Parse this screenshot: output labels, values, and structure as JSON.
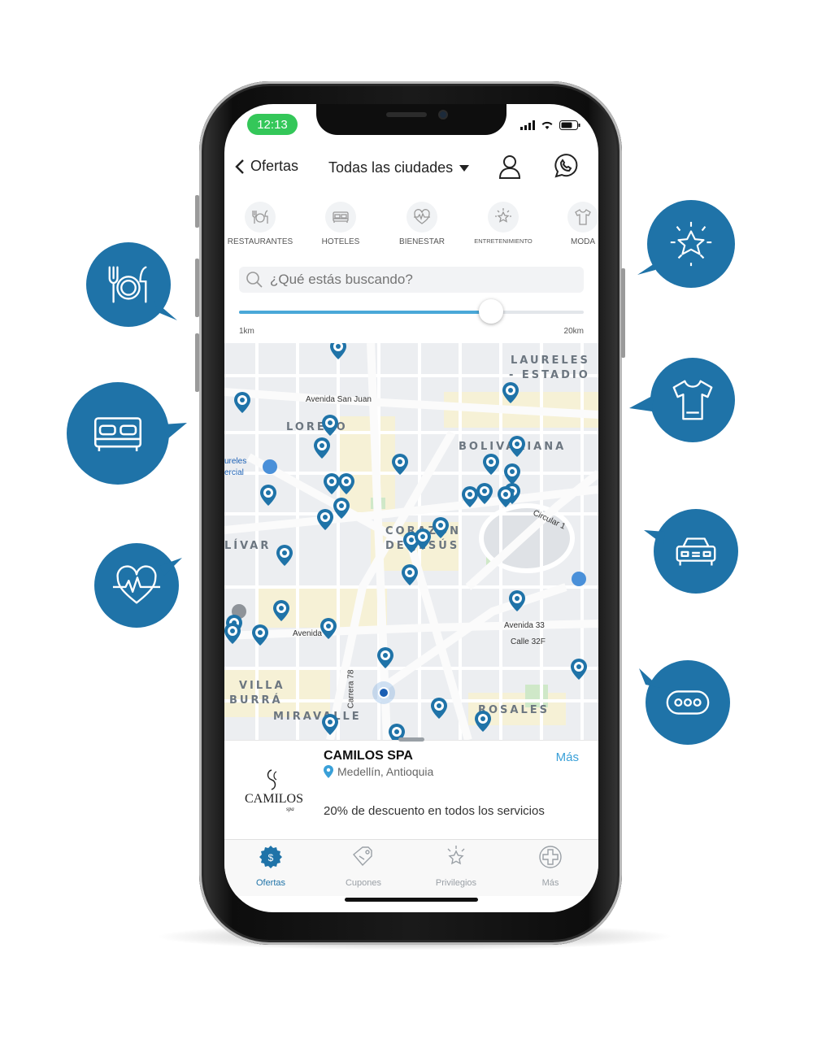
{
  "status": {
    "time": "12:13"
  },
  "header": {
    "back_label": "Ofertas",
    "city": "Todas las ciudades"
  },
  "categories": [
    {
      "label": "RESTAURANTES",
      "icon": "restaurant-icon"
    },
    {
      "label": "HOTELES",
      "icon": "bed-icon"
    },
    {
      "label": "BIENESTAR",
      "icon": "heart-pulse-icon"
    },
    {
      "label": "ENTRETENIMIENTO",
      "icon": "star-burst-icon"
    },
    {
      "label": "MODA",
      "icon": "tshirt-icon"
    }
  ],
  "search": {
    "placeholder": "¿Qué estás buscando?"
  },
  "radius": {
    "min_label": "1km",
    "max_label": "20km",
    "value_fraction": 0.73
  },
  "map": {
    "areas": {
      "laureles_1": "LAURELES",
      "laureles_2": "- ESTADIO",
      "loreto": "LORETO",
      "bolivariana": "BOLIVARIANA",
      "corazon": "CORAZÓN",
      "de_jesus": "DE JESÚS",
      "bolivar": "LÍVAR",
      "villa": "VILLA",
      "burra": "BURRÁ",
      "miravalle": "MIRAVALLE",
      "rosales": "ROSALES"
    },
    "streets": {
      "san_juan": "Avenida San Juan",
      "circular": "Circular 1",
      "av33": "Avenida 33",
      "calle32f": "Calle 32F",
      "carrera78": "Carrera 78",
      "avenida": "Avenida",
      "laureles_cc": "ureles",
      "comercial": "ercial"
    }
  },
  "offer": {
    "business": "CAMILOS SPA",
    "location": "Medellín, Antioquia",
    "more": "Más",
    "description": "20% de descuento en todos los servicios",
    "logo_text": "CAMILOS"
  },
  "tabs": [
    {
      "label": "Ofertas",
      "active": true
    },
    {
      "label": "Cupones",
      "active": false
    },
    {
      "label": "Privilegios",
      "active": false
    },
    {
      "label": "Más",
      "active": false
    }
  ],
  "colors": {
    "brand_blue": "#1f73a8",
    "accent": "#4aa8d8",
    "status_green": "#34c759"
  }
}
